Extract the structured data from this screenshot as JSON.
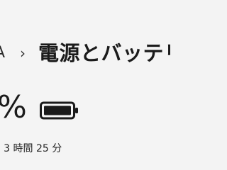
{
  "header": {
    "breadcrumb_parent": "A",
    "breadcrumb_separator": "›",
    "title": "電源とバッテリー"
  },
  "battery": {
    "percent_text": "%",
    "icon": "battery-full-icon",
    "charge_level": 1.0,
    "estimated_time": ": 3 時間 25 分"
  },
  "colors": {
    "background": "#f4f4f4",
    "text": "#1b1b1b"
  }
}
